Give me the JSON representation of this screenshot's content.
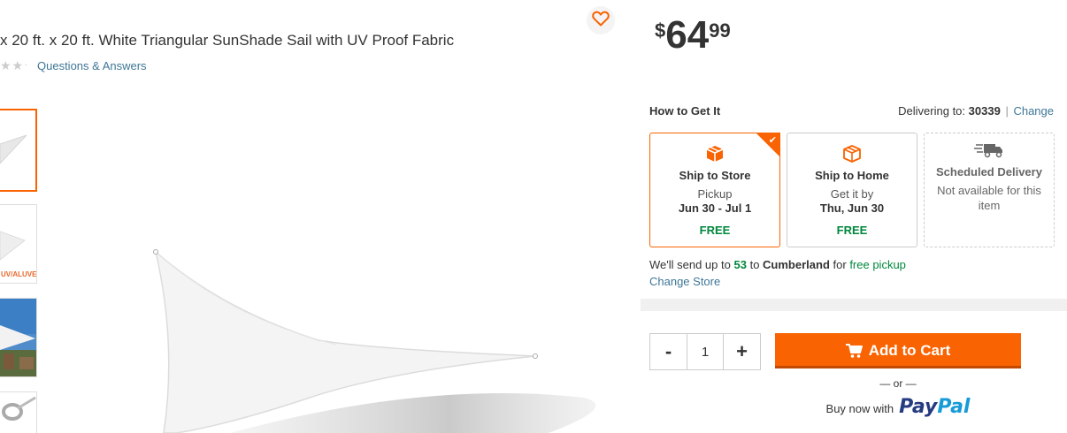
{
  "product": {
    "title": "x 20 ft. x 20 ft. White Triangular SunShade Sail with UV Proof Fabric",
    "stars": "★★★★★",
    "qa_link": "Questions & Answers"
  },
  "thumbnails": [
    {
      "label": "",
      "active": true
    },
    {
      "label": "UV/ALUVE",
      "active": false
    },
    {
      "label": "",
      "active": false
    },
    {
      "label": "",
      "active": false
    }
  ],
  "price": {
    "currency": "$",
    "dollars": "64",
    "cents": "99"
  },
  "fulfillment": {
    "title": "How to Get It",
    "delivering_label": "Delivering to:",
    "zip": "30339",
    "change_link": "Change",
    "separator": "|",
    "options": [
      {
        "title": "Ship to Store",
        "line1": "Pickup",
        "line2": "Jun 30 - Jul 1",
        "line3": "FREE"
      },
      {
        "title": "Ship to Home",
        "line1": "Get it by",
        "line2": "Thu, Jun 30",
        "line3": "FREE"
      },
      {
        "title": "Scheduled Delivery",
        "line1": "Not available for this item"
      }
    ],
    "send_prefix": "We'll send up to",
    "send_qty": "53",
    "send_to": "to",
    "store": "Cumberland",
    "send_for": "for",
    "free_pickup": "free pickup",
    "change_store": "Change Store"
  },
  "purchase": {
    "minus": "-",
    "quantity": "1",
    "plus": "+",
    "add_to_cart": "Add to Cart",
    "or": "— or —",
    "buy_now_with": "Buy now with",
    "paypal_1": "Pay",
    "paypal_2": "Pal"
  },
  "colors": {
    "accent": "#f96302",
    "link": "#3e7697",
    "free_green": "#00873c"
  }
}
